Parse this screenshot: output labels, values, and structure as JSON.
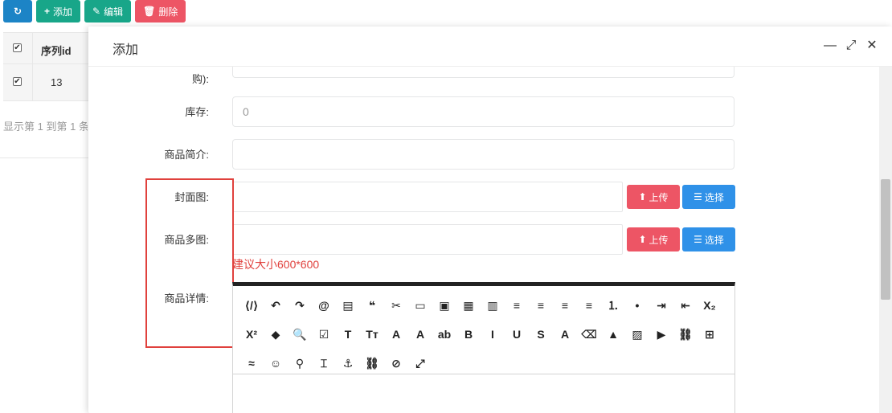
{
  "toolbar": {
    "refresh_icon": "↻",
    "add_icon": "+",
    "add_label": "添加",
    "edit_icon": "✎",
    "edit_label": "编辑",
    "delete_icon": "🗑",
    "delete_label": "删除"
  },
  "table": {
    "header": "序列id",
    "row_id": "13",
    "footer": "显示第 1 到第 1 条"
  },
  "modal": {
    "title": "添加",
    "minimize": "—",
    "maximize": "⤢",
    "close": "✕"
  },
  "form": {
    "prev_label_tail": "购):",
    "stock_label": "库存:",
    "stock_placeholder": "0",
    "intro_label": "商品简介:",
    "cover_label": "封面图:",
    "multi_label": "商品多图:",
    "upload_label": "上传",
    "select_label": "选择",
    "size_hint": "建议大小600*600",
    "detail_label": "商品详情:"
  },
  "editor": {
    "row1": [
      "⟨/⟩",
      "↶",
      "↷",
      "@",
      "▤",
      "❝",
      "✂",
      "▭",
      "▣",
      "▦",
      "▥",
      "≡",
      "≡",
      "≡",
      "≡",
      "⒈",
      "•",
      "⇥",
      "⇤",
      "X₂"
    ],
    "row2": [
      "X²",
      "◆",
      "🔍",
      "☑",
      "T",
      "Tт",
      "A",
      "A",
      "ab",
      "B",
      "I",
      "U",
      "S",
      "A",
      "⌫",
      "▲",
      "▨",
      "▶",
      "⛓",
      "⊞"
    ],
    "row3": [
      "≈",
      "☺",
      "⚲",
      "⌶",
      "⚓",
      "⛓",
      "⊘",
      "⤢"
    ]
  }
}
